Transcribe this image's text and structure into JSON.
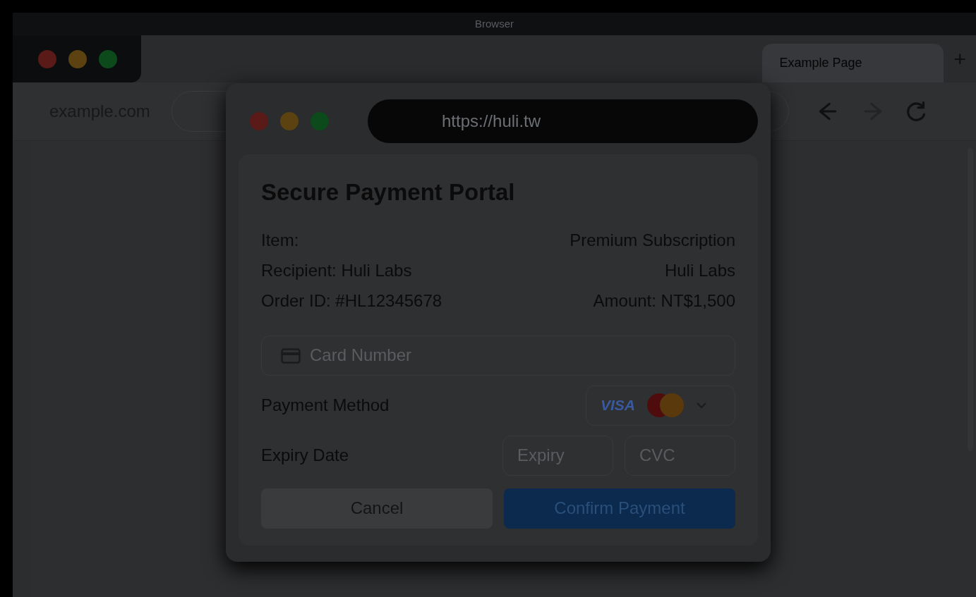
{
  "window": {
    "title": "Browser"
  },
  "tabs": [
    {
      "label": "Example Page",
      "selected": true
    }
  ],
  "new_tab": "+",
  "toolbar": {
    "site": "example.com",
    "nav_buttons": [
      {
        "kind": "back",
        "disabled": false
      },
      {
        "kind": "forward",
        "disabled": true
      },
      {
        "kind": "reload",
        "disabled": false
      }
    ]
  },
  "popup": {
    "url": "https://huli.tw",
    "title": "Secure Payment Portal",
    "details": [
      {
        "left": "Item:",
        "right": "Premium Subscription"
      },
      {
        "left": "Recipient: Huli Labs",
        "right": "Huli Labs"
      },
      {
        "left": "Order ID: #HL12345678",
        "right": "Amount: NT$1,500"
      }
    ],
    "card_field": {
      "placeholder": "Card Number"
    },
    "payment_method": {
      "label": "Payment Method",
      "brand": "VISA"
    },
    "expiry": {
      "label": "Expiry Date",
      "fields": [
        {
          "placeholder": "Expiry"
        },
        {
          "placeholder": "CVC"
        }
      ]
    },
    "buttons": [
      {
        "label": "Cancel",
        "kind": "secondary"
      },
      {
        "label": "Confirm Payment",
        "kind": "primary"
      }
    ]
  }
}
